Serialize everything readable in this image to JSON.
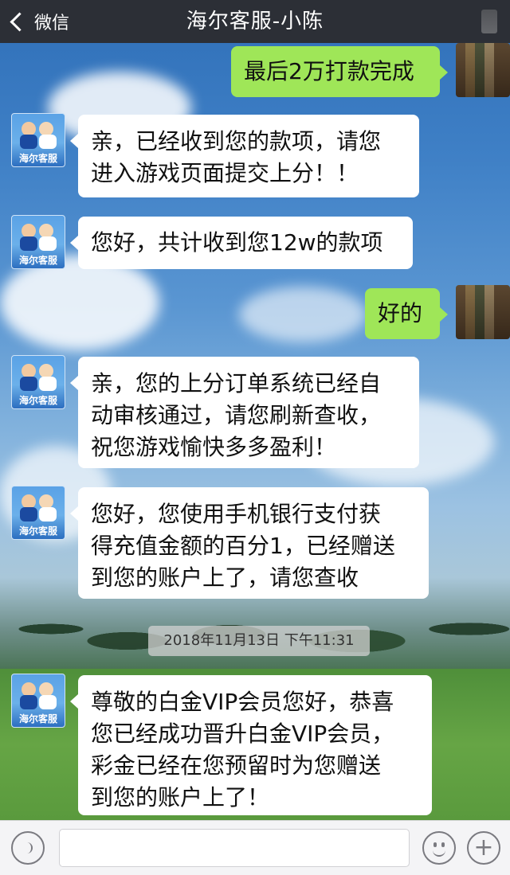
{
  "header": {
    "back_label": "微信",
    "title": "海尔客服-小陈"
  },
  "contact": {
    "avatar_label": "海尔客服"
  },
  "messages": [
    {
      "side": "right",
      "text": "最后2万打款完成"
    },
    {
      "side": "left",
      "lines": [
        "亲，已经收到您的款项，请您",
        "进入游戏页面提交上分！！"
      ]
    },
    {
      "side": "left",
      "text": "您好，共计收到您12w的款项"
    },
    {
      "side": "right",
      "text": "好的"
    },
    {
      "side": "left",
      "lines": [
        "亲，您的上分订单系统已经自",
        "动审核通过，请您刷新查收，",
        "祝您游戏愉快多多盈利！"
      ]
    },
    {
      "side": "left",
      "lines": [
        "您好，您使用手机银行支付获",
        "得充值金额的百分1，已经赠送",
        "到您的账户上了，请您查收"
      ]
    },
    {
      "side": "left",
      "lines": [
        "尊敬的白金VIP会员您好，恭喜",
        "您已经成功晋升白金VIP会员，",
        "彩金已经在您预留时为您赠送",
        "到您的账户上了！"
      ]
    }
  ],
  "timestamp": "2018年11月13日 下午11:31",
  "input_bar": {
    "voice_icon": "voice-icon",
    "emoji_icon": "emoji-icon",
    "plus_icon": "plus-icon",
    "plus_symbol": "+"
  }
}
